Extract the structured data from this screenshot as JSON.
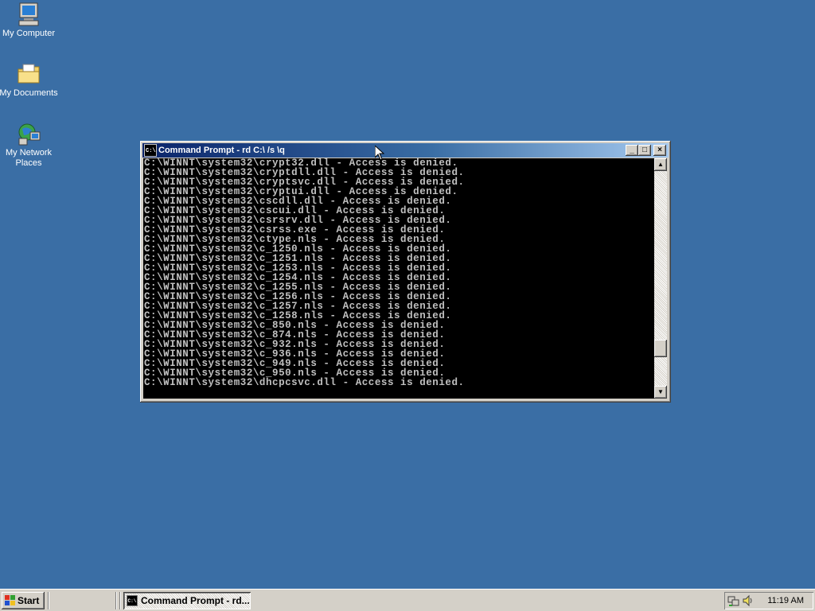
{
  "desktop": {
    "icons": [
      {
        "label": "My Computer"
      },
      {
        "label": "My Documents"
      },
      {
        "label": "My Network Places"
      }
    ]
  },
  "window": {
    "title": "Command Prompt - rd C:\\ /s \\q",
    "controls": {
      "minimize": "_",
      "maximize": "□",
      "close": "×"
    },
    "console_lines": [
      "C:\\WINNT\\system32\\crypt32.dll - Access is denied.",
      "C:\\WINNT\\system32\\cryptdll.dll - Access is denied.",
      "C:\\WINNT\\system32\\cryptsvc.dll - Access is denied.",
      "C:\\WINNT\\system32\\cryptui.dll - Access is denied.",
      "C:\\WINNT\\system32\\cscdll.dll - Access is denied.",
      "C:\\WINNT\\system32\\cscui.dll - Access is denied.",
      "C:\\WINNT\\system32\\csrsrv.dll - Access is denied.",
      "C:\\WINNT\\system32\\csrss.exe - Access is denied.",
      "C:\\WINNT\\system32\\ctype.nls - Access is denied.",
      "C:\\WINNT\\system32\\c_1250.nls - Access is denied.",
      "C:\\WINNT\\system32\\c_1251.nls - Access is denied.",
      "C:\\WINNT\\system32\\c_1253.nls - Access is denied.",
      "C:\\WINNT\\system32\\c_1254.nls - Access is denied.",
      "C:\\WINNT\\system32\\c_1255.nls - Access is denied.",
      "C:\\WINNT\\system32\\c_1256.nls - Access is denied.",
      "C:\\WINNT\\system32\\c_1257.nls - Access is denied.",
      "C:\\WINNT\\system32\\c_1258.nls - Access is denied.",
      "C:\\WINNT\\system32\\c_850.nls - Access is denied.",
      "C:\\WINNT\\system32\\c_874.nls - Access is denied.",
      "C:\\WINNT\\system32\\c_932.nls - Access is denied.",
      "C:\\WINNT\\system32\\c_936.nls - Access is denied.",
      "C:\\WINNT\\system32\\c_949.nls - Access is denied.",
      "C:\\WINNT\\system32\\c_950.nls - Access is denied.",
      "C:\\WINNT\\system32\\dhcpcsvc.dll - Access is denied."
    ]
  },
  "taskbar": {
    "start_label": "Start",
    "task_label": "Command Prompt - rd...",
    "clock": "11:19 AM"
  },
  "colors": {
    "desktop": "#3a6ea5",
    "console_bg": "#000000",
    "console_text": "#c0c0c0",
    "title_active": "#0a246a"
  }
}
